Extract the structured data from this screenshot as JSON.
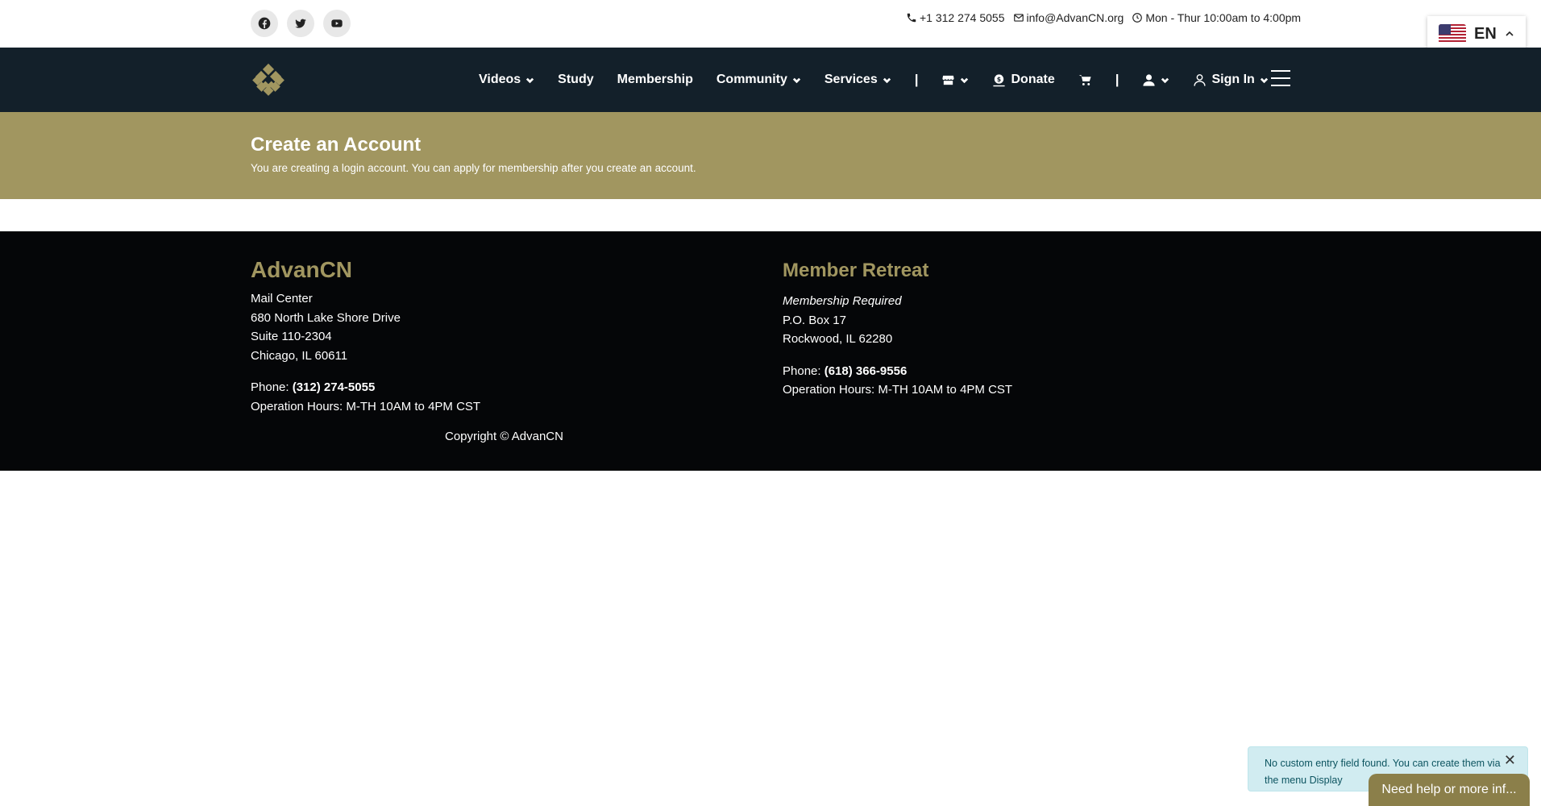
{
  "topbar": {
    "social": [
      {
        "icon": "facebook-icon"
      },
      {
        "icon": "twitter-icon"
      },
      {
        "icon": "youtube-icon"
      }
    ],
    "phone": "+1 312 274 5055",
    "email": "info@AdvanCN.org",
    "hours": "Mon - Thur 10:00am to 4:00pm"
  },
  "language": {
    "code": "EN"
  },
  "nav": {
    "videos": "Videos",
    "study": "Study",
    "membership": "Membership",
    "community": "Community",
    "services": "Services",
    "separator": "|",
    "donate": "Donate",
    "sign_in": "Sign In"
  },
  "page": {
    "title": "Create an Account",
    "subtitle": "You are creating a login account. You can apply for membership after you create an account."
  },
  "footer": {
    "left": {
      "title": "AdvanCN",
      "line1": "Mail Center",
      "line2": "680 North Lake Shore Drive",
      "line3": "Suite 110-2304",
      "line4": "Chicago, IL 60611",
      "phone_label": "Phone: ",
      "phone": "(312) 274-5055",
      "hours": "Operation Hours: M-TH 10AM to 4PM CST"
    },
    "right": {
      "title": "Member Retreat",
      "note": "Membership Required",
      "line1": "P.O. Box 17",
      "line2": "Rockwood, IL 62280",
      "phone_label": "Phone: ",
      "phone": "(618) 366-9556",
      "hours": "Operation Hours: M-TH 10AM to 4PM CST"
    },
    "copyright": "Copyright © AdvanCN"
  },
  "notice": {
    "text": "No custom entry field found. You can create them via the menu Display",
    "close": "✕"
  },
  "help_button": "Need help or more inf..."
}
